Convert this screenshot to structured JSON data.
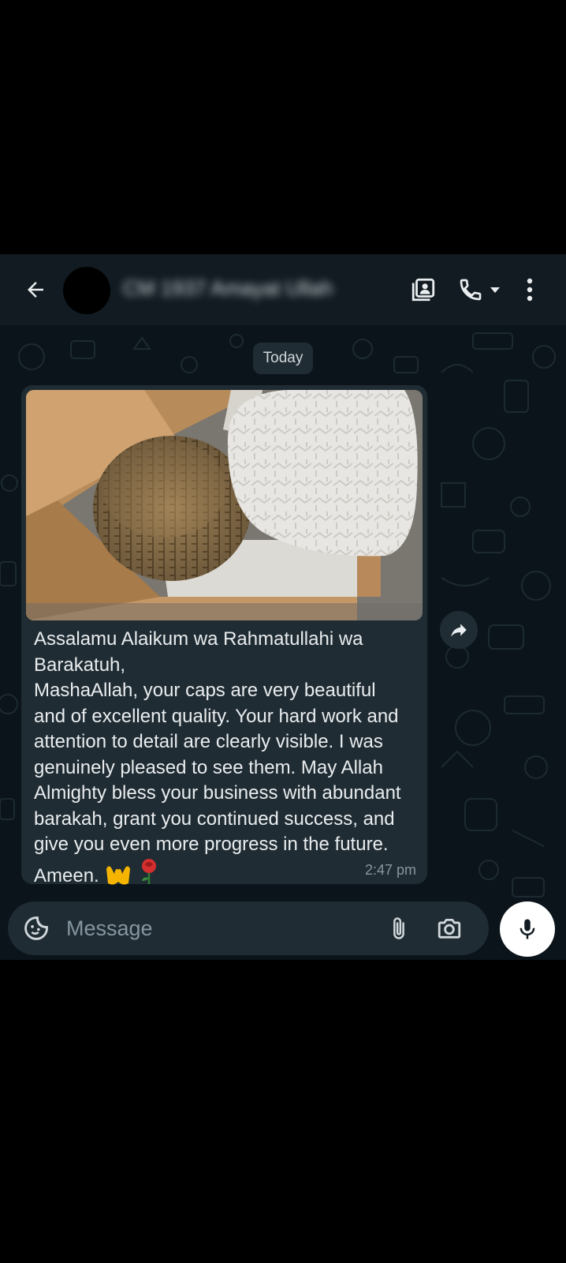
{
  "header": {
    "contact_name": "CM 1937 Amayat Ullah",
    "icons": [
      "back-arrow-icon",
      "contact-card-icon",
      "phone-icon",
      "dropdown-icon",
      "more-vert-icon"
    ]
  },
  "chat": {
    "date_label": "Today",
    "message": {
      "text": "Assalamu Alaikum wa Rahmatullahi wa Barakatuh,\nMashaAllah, your caps are very beautiful and of excellent quality. Your hard work and attention to detail are clearly visible. I was genuinely pleased to see them. May Allah Almighty bless your business with abundant barakah, grant you continued success, and give you even more progress in the future. Ameen.",
      "emojis": [
        "raising-hands",
        "rose"
      ],
      "time": "2:47 pm"
    }
  },
  "input": {
    "placeholder": "Message",
    "icons": [
      "sticker-icon",
      "attach-icon",
      "camera-icon",
      "mic-icon"
    ]
  },
  "colors": {
    "background": "#0b141a",
    "header": "#111b21",
    "bubble": "#202c33",
    "text": "#e9edef",
    "muted": "#8696a0"
  }
}
